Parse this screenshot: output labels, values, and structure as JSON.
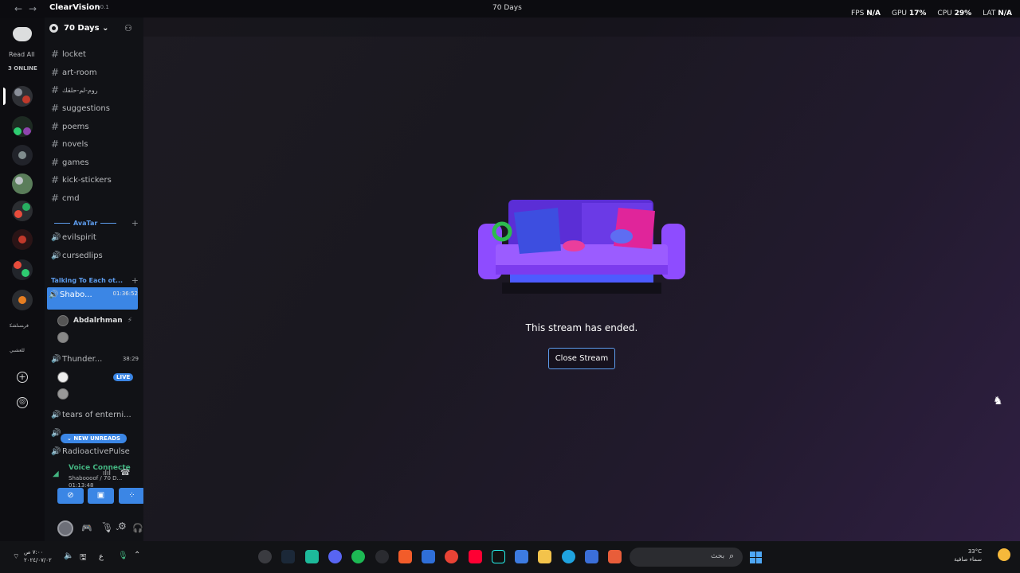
{
  "topbar": {
    "app_name": "ClearVision",
    "app_version": "7.0.1",
    "window_title": "70 Days",
    "fps_label": "FPS",
    "fps_value": "N/A",
    "gpu_label": "GPU",
    "gpu_value": "17%",
    "cpu_label": "CPU",
    "cpu_value": "29%",
    "lat_label": "LAT",
    "lat_value": "N/A"
  },
  "rail": {
    "read_all": "Read All",
    "online": "3 ONLINE",
    "text_a": "ﻓﺮﻨﺴﺎﺸﻜ",
    "text_b": "ﻟﻠﻌﺸﺒﻲ"
  },
  "server": {
    "name": "70 Days"
  },
  "channels": [
    {
      "name": "locket"
    },
    {
      "name": "art-room"
    },
    {
      "name": "روم-لم-حلقك"
    },
    {
      "name": "suggestions"
    },
    {
      "name": "poems"
    },
    {
      "name": "novels"
    },
    {
      "name": "games"
    },
    {
      "name": "kick-stickers"
    },
    {
      "name": "cmd"
    }
  ],
  "categories": {
    "avatar": "AvaTar",
    "talking": "Talking To Each ot..."
  },
  "avatar_voice": [
    {
      "name": "evilspirit"
    },
    {
      "name": "cursedlips"
    }
  ],
  "talking_voice": {
    "active": {
      "name": "Shabo...",
      "timer": "01:36:52"
    },
    "member": "Abdalrhman",
    "thunder": {
      "name": "Thunder...",
      "timer": "38:29"
    },
    "live_badge": "LIVE",
    "tears": "tears of enterni...",
    "radioactive": "RadioactivePulse",
    "new_unreads": "NEW UNREADS"
  },
  "voice_panel": {
    "status": "Voice Connecte",
    "channel": "Shaboooof / 70 D...",
    "time": "01:13:48"
  },
  "main": {
    "ended_text": "This stream has ended.",
    "close_label": "Close Stream"
  },
  "taskbar": {
    "time": "٧:٠٠ ص",
    "date": "٢٠٢٤/٠٧/٠٢",
    "lang": "ع",
    "search_label": "بحث",
    "temp": "33°C",
    "weather": "سماء صافية"
  },
  "colors": {
    "accent": "#3b86e5",
    "voice_green": "#43b581"
  }
}
